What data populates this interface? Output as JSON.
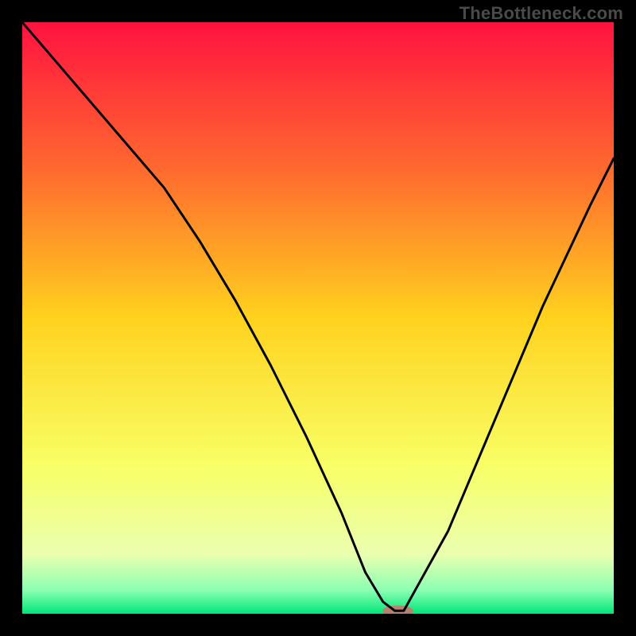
{
  "watermark": "TheBottleneck.com",
  "chart_data": {
    "type": "line",
    "title": "",
    "xlabel": "",
    "ylabel": "",
    "xlim": [
      0,
      100
    ],
    "ylim": [
      0,
      100
    ],
    "background": {
      "gradient_stops": [
        {
          "offset": 0,
          "color": "#ff1240"
        },
        {
          "offset": 25,
          "color": "#ff6a2f"
        },
        {
          "offset": 50,
          "color": "#ffd21e"
        },
        {
          "offset": 75,
          "color": "#f8ff66"
        },
        {
          "offset": 90,
          "color": "#eaffb0"
        },
        {
          "offset": 96,
          "color": "#8cffb2"
        },
        {
          "offset": 100,
          "color": "#00e67a"
        }
      ]
    },
    "series": [
      {
        "name": "bottleneck-curve",
        "color": "#000000",
        "x": [
          0,
          6,
          12,
          18,
          24,
          30,
          36,
          42,
          48,
          54,
          58,
          61,
          63,
          64.5,
          72,
          80,
          88,
          96,
          100
        ],
        "y": [
          100,
          93,
          86,
          79,
          72,
          63,
          53,
          42,
          30,
          17,
          7,
          2,
          0.5,
          0.5,
          14,
          33,
          52,
          69,
          77
        ]
      }
    ],
    "marker": {
      "name": "optimal-point",
      "color": "#d86b6b",
      "opacity": 0.82,
      "x": 63.5,
      "y": 0.5,
      "rx": 2.6,
      "ry": 0.9
    }
  }
}
